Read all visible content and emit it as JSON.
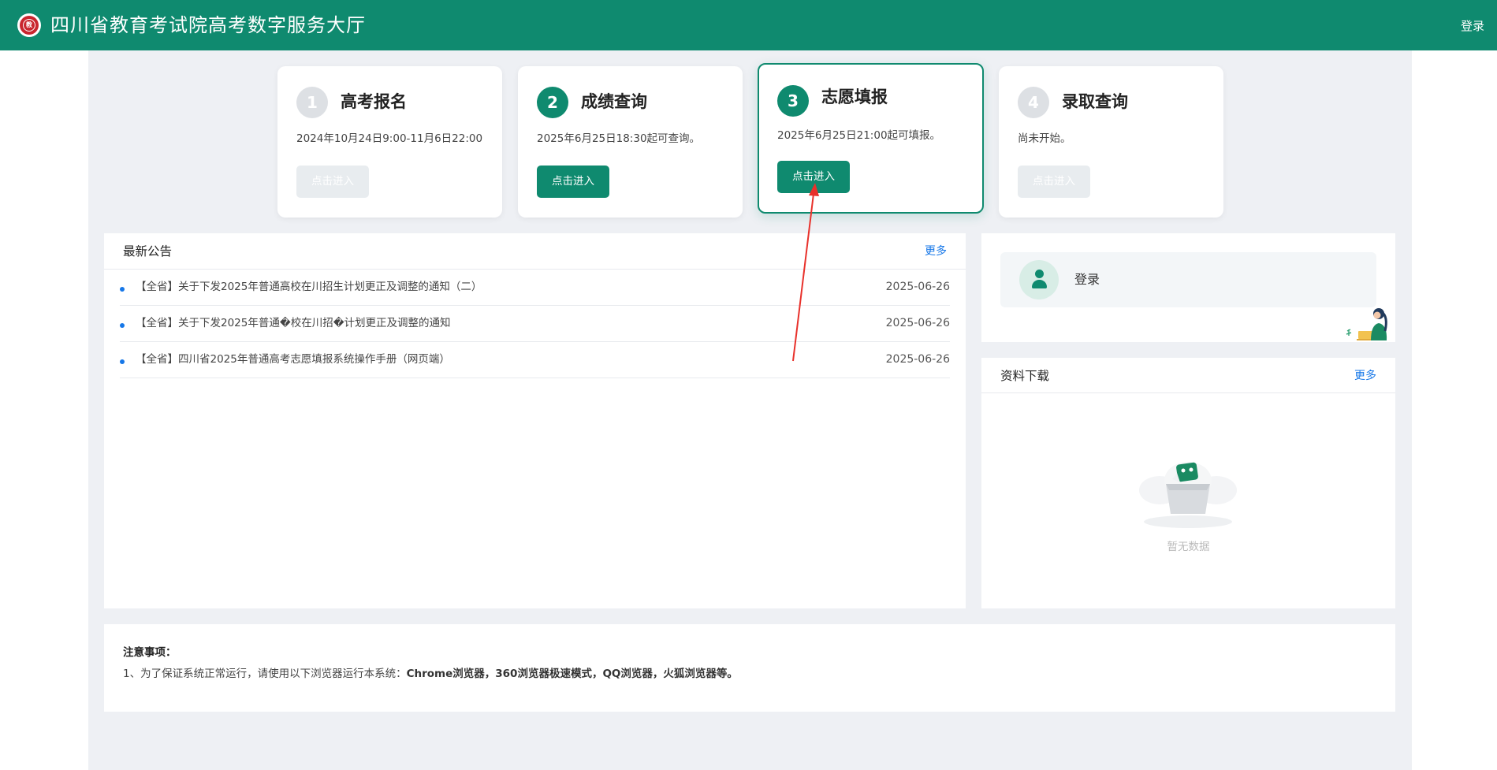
{
  "header": {
    "logo_text": "教",
    "title": "四川省教育考试院高考数字服务大厅",
    "login": "登录",
    "color": "#0f8a6f"
  },
  "steps": [
    {
      "num": "1",
      "title": "高考报名",
      "desc": "2024年10月24日9:00-11月6日22:00",
      "button": "点击进入",
      "enabled": false
    },
    {
      "num": "2",
      "title": "成绩查询",
      "desc": "2025年6月25日18:30起可查询。",
      "button": "点击进入",
      "enabled": true
    },
    {
      "num": "3",
      "title": "志愿填报",
      "desc": "2025年6月25日21:00起可填报。",
      "button": "点击进入",
      "enabled": true,
      "active": true
    },
    {
      "num": "4",
      "title": "录取查询",
      "desc": "尚未开始。",
      "button": "点击进入",
      "enabled": false
    }
  ],
  "announcements": {
    "title": "最新公告",
    "more": "更多",
    "items": [
      {
        "title": "【全省】关于下发2025年普通高校在川招生计划更正及调整的通知（二）",
        "date": "2025-06-26"
      },
      {
        "title": "【全省】关于下发2025年普通�校在川招�计划更正及调整的通知",
        "date": "2025-06-26"
      },
      {
        "title": "【全省】四川省2025年普通高考志愿填报系统操作手册（网页端）",
        "date": "2025-06-26"
      }
    ]
  },
  "login_panel": {
    "label": "登录",
    "icon": "user-icon"
  },
  "downloads": {
    "title": "资料下载",
    "more": "更多",
    "empty": "暂无数据",
    "icon": "empty-box-icon"
  },
  "notice": {
    "title": "注意事项：",
    "prefix": "1、为了保证系统正常运行，请使用以下浏览器运行本系统：",
    "browsers": "Chrome浏览器，360浏览器极速模式，QQ浏览器，火狐浏览器等。"
  },
  "colors": {
    "accent": "#0f8a6f",
    "link": "#1677e8",
    "arrow": "#e8312b",
    "background": "#eef0f4"
  }
}
